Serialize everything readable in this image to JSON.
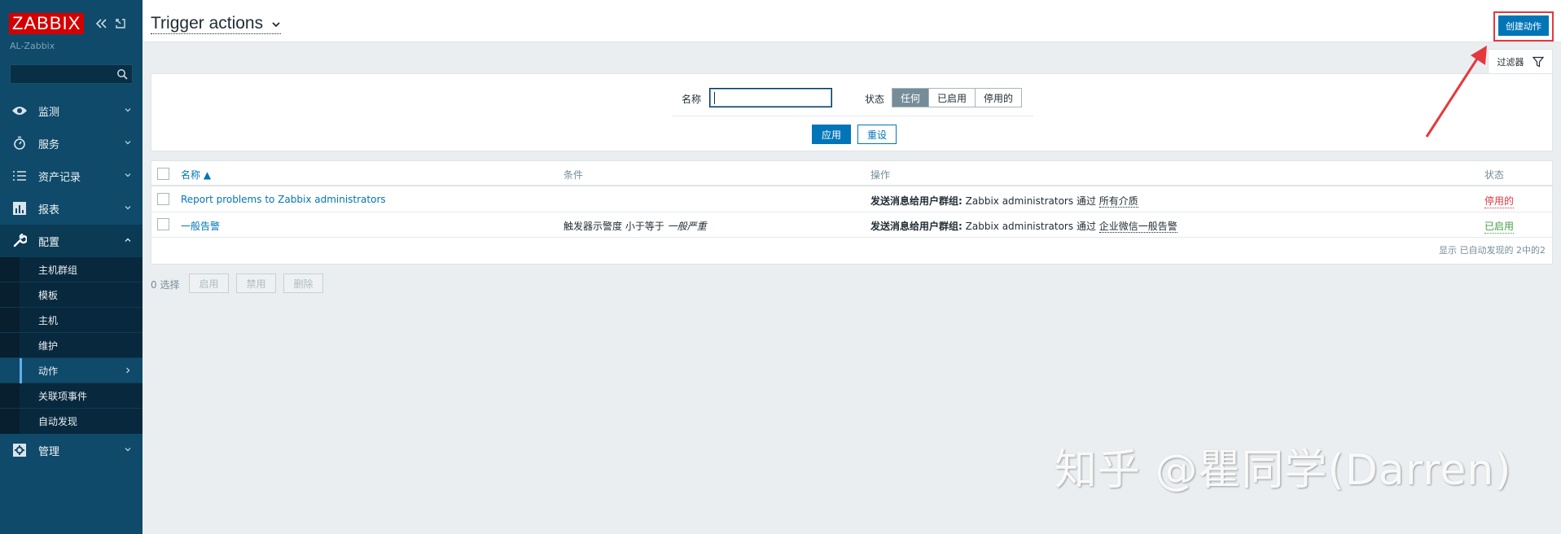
{
  "sidebar": {
    "logo": "ZABBIX",
    "server_name": "AL-Zabbix",
    "search_placeholder": "",
    "menu": [
      {
        "label": "监测",
        "icon": "eye-icon"
      },
      {
        "label": "服务",
        "icon": "stopwatch-icon"
      },
      {
        "label": "资产记录",
        "icon": "list-icon"
      },
      {
        "label": "报表",
        "icon": "bar-chart-icon"
      },
      {
        "label": "配置",
        "icon": "wrench-icon"
      },
      {
        "label": "管理",
        "icon": "gear-icon"
      }
    ],
    "submenu": [
      "主机群组",
      "模板",
      "主机",
      "维护",
      "动作",
      "关联项事件",
      "自动发现"
    ]
  },
  "header": {
    "title": "Trigger actions",
    "create_button": "创建动作"
  },
  "filter": {
    "tab_label": "过滤器",
    "name_label": "名称",
    "name_value": "",
    "status_label": "状态",
    "status_options": [
      "任何",
      "已启用",
      "停用的"
    ],
    "status_selected": "任何",
    "apply": "应用",
    "reset": "重设"
  },
  "table": {
    "columns": [
      "名称 ▲",
      "条件",
      "操作",
      "状态"
    ],
    "rows": [
      {
        "name": "Report problems to Zabbix administrators",
        "condition": "",
        "op_prefix": "发送消息给用户群组:",
        "op_group": "Zabbix administrators",
        "op_via": "通过",
        "op_media": "所有介质",
        "status": "停用的"
      },
      {
        "name": "一般告警",
        "condition_prefix": "触发器示警度 小于等于",
        "condition_value": "一般严重",
        "op_prefix": "发送消息给用户群组:",
        "op_group": "Zabbix administrators",
        "op_via": "通过",
        "op_media": "企业微信一般告警",
        "status": "已启用"
      }
    ],
    "footer": "显示 已自动发现的 2中的2"
  },
  "actions": {
    "selected": "0 选择",
    "enable": "启用",
    "disable": "禁用",
    "delete": "删除"
  },
  "watermark": "知乎 @瞿同学(Darren)",
  "colors": {
    "sidebar_bg": "#0f4a6b",
    "accent": "#0275b8",
    "logo_red": "#d40000",
    "annotation": "#e5383e"
  }
}
